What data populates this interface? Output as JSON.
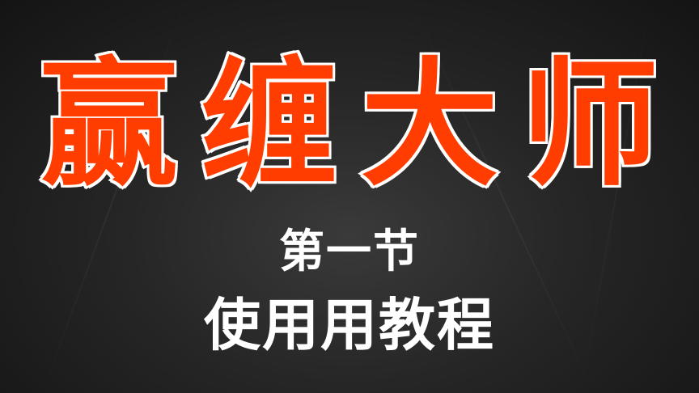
{
  "title": "赢缠大师",
  "subtitle_line1": "第一节",
  "subtitle_line2": "使用用教程",
  "colors": {
    "title_fill": "#ff3d00",
    "title_outline": "#ffffff",
    "subtitle": "#ffffff",
    "background": "#262626"
  }
}
